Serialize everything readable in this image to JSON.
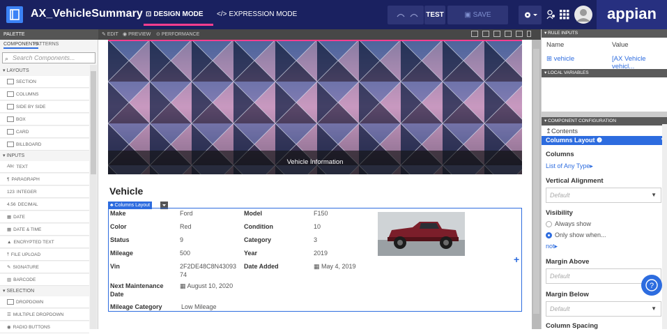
{
  "app": {
    "title": "AX_VehicleSummary",
    "logo_text": "appian"
  },
  "modes": {
    "design": "DESIGN MODE",
    "expression": "EXPRESSION MODE"
  },
  "toolbar": {
    "test": "TEST",
    "save": "SAVE CHANGES"
  },
  "palette": {
    "header": "PALETTE",
    "tabs": [
      "COMPONENTS",
      "PATTERNS"
    ],
    "search_placeholder": "Search Components...",
    "categories": [
      {
        "name": "LAYOUTS",
        "items": [
          "SECTION",
          "COLUMNS",
          "SIDE BY SIDE",
          "BOX",
          "CARD",
          "BILLBOARD"
        ]
      },
      {
        "name": "INPUTS",
        "items": [
          "TEXT",
          "PARAGRAPH",
          "INTEGER",
          "DECIMAL",
          "DATE",
          "DATE & TIME",
          "ENCRYPTED TEXT",
          "FILE UPLOAD",
          "SIGNATURE",
          "BARCODE"
        ]
      },
      {
        "name": "SELECTION",
        "items": [
          "DROPDOWN",
          "MULTIPLE DROPDOWN",
          "RADIO BUTTONS"
        ]
      }
    ]
  },
  "canvas": {
    "tabs": [
      "EDIT",
      "PREVIEW",
      "PERFORMANCE"
    ],
    "billboard_caption": "Vehicle Information",
    "section_title": "Vehicle",
    "columns_tag": "Columns Layout",
    "fields_left": [
      {
        "label": "Make",
        "value": "Ford"
      },
      {
        "label": "Color",
        "value": "Red"
      },
      {
        "label": "Status",
        "value": "9"
      },
      {
        "label": "Mileage",
        "value": "500"
      },
      {
        "label": "Vin",
        "value": "2F2DE48C8N43093"
      },
      {
        "label": "Next Maintenance",
        "value": "August 10, 2020"
      },
      {
        "label": "Mileage Category",
        "value": "Low Mileage"
      }
    ],
    "vin_cont": "74",
    "next_maint_cont": "Date",
    "fields_right": [
      {
        "label": "Model",
        "value": "F150"
      },
      {
        "label": "Condition",
        "value": "10"
      },
      {
        "label": "Category",
        "value": "3"
      },
      {
        "label": "Year",
        "value": "2019"
      },
      {
        "label": "Date Added",
        "value": "May 4, 2019"
      }
    ]
  },
  "rule_inputs": {
    "header": "RULE INPUTS",
    "col_name": "Name",
    "col_value": "Value",
    "var_name": "vehicle",
    "var_value": "[AX Vehicle vehicl..."
  },
  "local_variables": {
    "header": "LOCAL VARIABLES"
  },
  "component_config": {
    "header": "COMPONENT CONFIGURATION",
    "contents": "Contents",
    "type": "Columns Layout",
    "columns_label": "Columns",
    "columns_link": "List of Any Type",
    "valign_label": "Vertical Alignment",
    "valign_placeholder": "Default",
    "visibility_label": "Visibility",
    "vis_opt1": "Always show",
    "vis_opt2": "Only show when...",
    "not_link": "not",
    "margin_above_label": "Margin Above",
    "margin_above_placeholder": "Default",
    "margin_below_label": "Margin Below",
    "margin_below_placeholder": "Default",
    "col_spacing_label": "Column Spacing"
  }
}
